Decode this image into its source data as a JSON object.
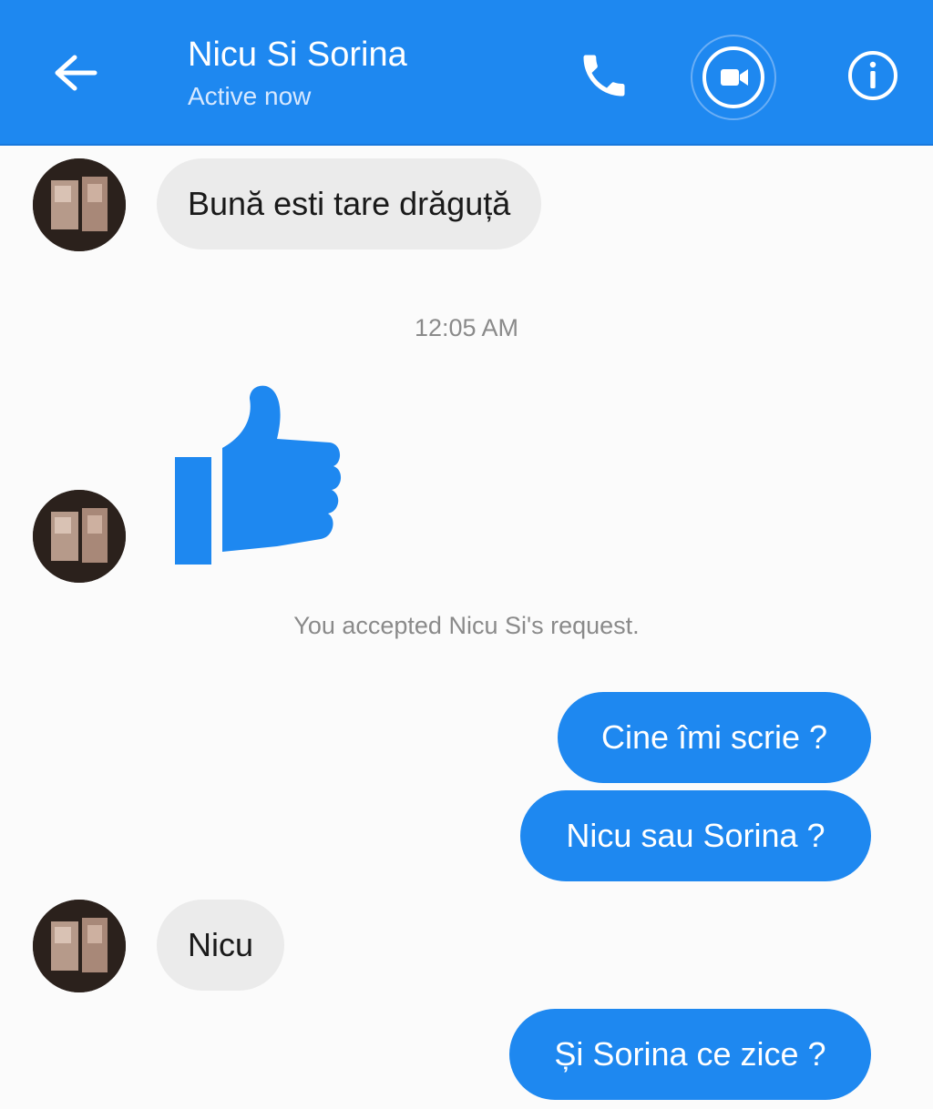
{
  "header": {
    "back_icon": "arrow-left-icon",
    "title": "Nicu Si Sorina",
    "status": "Active now",
    "call_icon": "phone-icon",
    "video_icon": "video-camera-icon",
    "info_icon": "info-icon",
    "color": "#1e88f0"
  },
  "messages": [
    {
      "from": "them",
      "text": "Bună esti tare drăguță"
    },
    {
      "from": "them",
      "sticker": "thumbs-up-icon"
    },
    {
      "from": "me",
      "text": "Cine îmi scrie ?"
    },
    {
      "from": "me",
      "text": "Nicu sau Sorina ?"
    },
    {
      "from": "them",
      "text": "Nicu"
    },
    {
      "from": "me",
      "text": "Și Sorina ce zice ?"
    }
  ],
  "system": {
    "timestamp": "12:05 AM",
    "accepted": "You accepted Nicu Si's request."
  },
  "colors": {
    "accent": "#1e88f0",
    "incoming_bubble": "#ebebeb",
    "background": "#fbfbfb"
  }
}
